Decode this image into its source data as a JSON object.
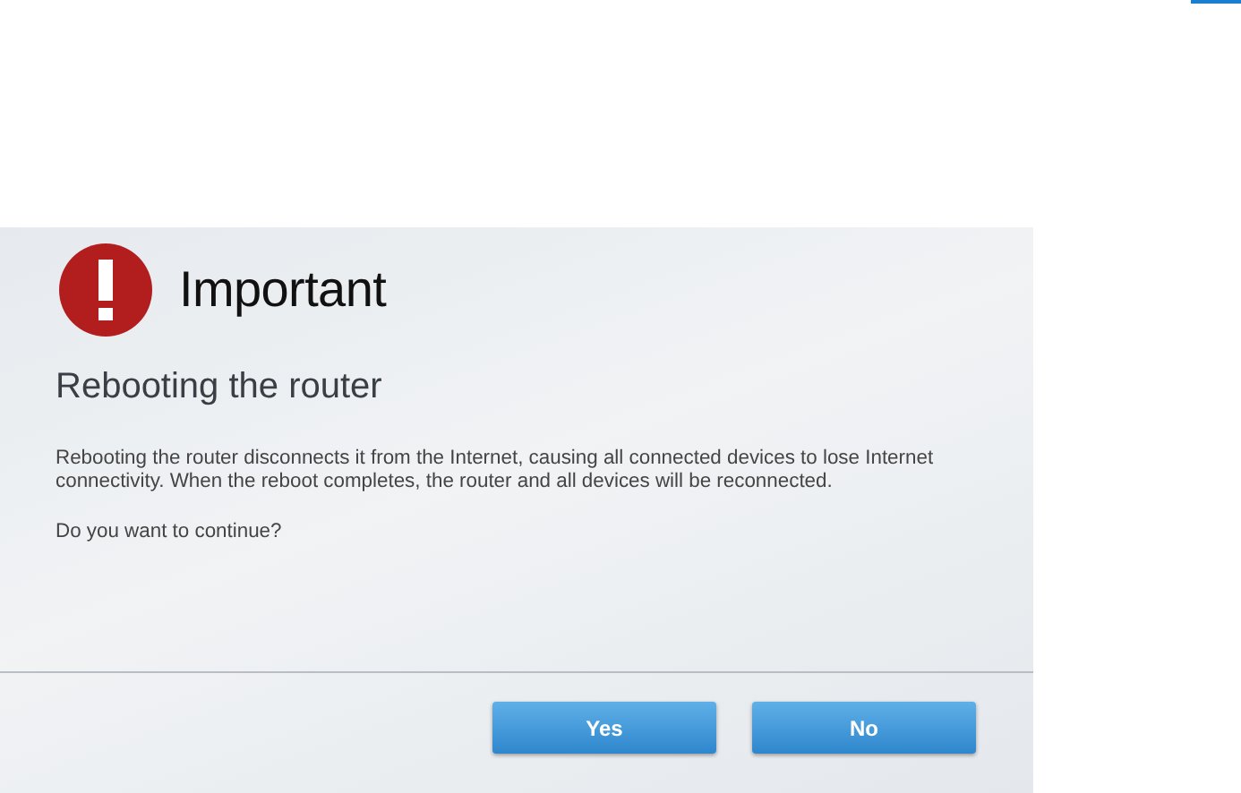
{
  "dialog": {
    "title": "Important",
    "heading": "Rebooting the router",
    "message": "Rebooting the router disconnects it from the Internet, causing all connected devices to lose Internet connectivity. When the reboot completes, the router and all devices will be reconnected.",
    "question": "Do you want to continue?",
    "buttons": [
      "Yes",
      "No"
    ]
  }
}
